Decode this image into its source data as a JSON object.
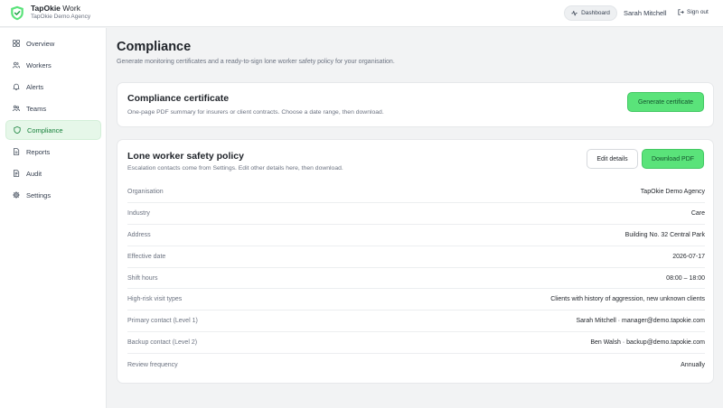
{
  "app": {
    "brand_bold": "TapOkie",
    "brand_light": "Work",
    "org_name": "TapOkie Demo Agency",
    "accent_color": "#5ae37a",
    "logo_icon": "shield-check-icon"
  },
  "header": {
    "dashboard_label": "Dashboard",
    "user_name": "Sarah Mitchell",
    "signout_label": "Sign out"
  },
  "sidebar": {
    "items": [
      {
        "label": "Overview",
        "icon": "grid-icon",
        "active": false
      },
      {
        "label": "Workers",
        "icon": "users-icon",
        "active": false
      },
      {
        "label": "Alerts",
        "icon": "bell-icon",
        "active": false
      },
      {
        "label": "Teams",
        "icon": "team-icon",
        "active": false
      },
      {
        "label": "Compliance",
        "icon": "shield-icon",
        "active": true
      },
      {
        "label": "Reports",
        "icon": "document-icon",
        "active": false
      },
      {
        "label": "Audit",
        "icon": "audit-icon",
        "active": false
      },
      {
        "label": "Settings",
        "icon": "gear-icon",
        "active": false
      }
    ]
  },
  "page": {
    "title": "Compliance",
    "subtitle": "Generate monitoring certificates and a ready-to-sign lone worker safety policy for your organisation."
  },
  "certificate": {
    "title": "Compliance certificate",
    "description": "One-page PDF summary for insurers or client contracts. Choose a date range, then download.",
    "button_label": "Generate certificate"
  },
  "policy": {
    "title": "Lone worker safety policy",
    "description": "Escalation contacts come from Settings. Edit other details here, then download.",
    "edit_label": "Edit details",
    "download_label": "Download PDF",
    "rows": [
      {
        "label": "Organisation",
        "value": "TapOkie Demo Agency"
      },
      {
        "label": "Industry",
        "value": "Care"
      },
      {
        "label": "Address",
        "value": "Building No. 32 Central Park"
      },
      {
        "label": "Effective date",
        "value": "2026-07-17"
      },
      {
        "label": "Shift hours",
        "value": "08:00 – 18:00"
      },
      {
        "label": "High-risk visit types",
        "value": "Clients with history of aggression, new unknown clients"
      },
      {
        "label": "Primary contact (Level 1)",
        "value": "Sarah Mitchell · manager@demo.tapokie.com"
      },
      {
        "label": "Backup contact (Level 2)",
        "value": "Ben Walsh · backup@demo.tapokie.com"
      },
      {
        "label": "Review frequency",
        "value": "Annually"
      }
    ]
  }
}
